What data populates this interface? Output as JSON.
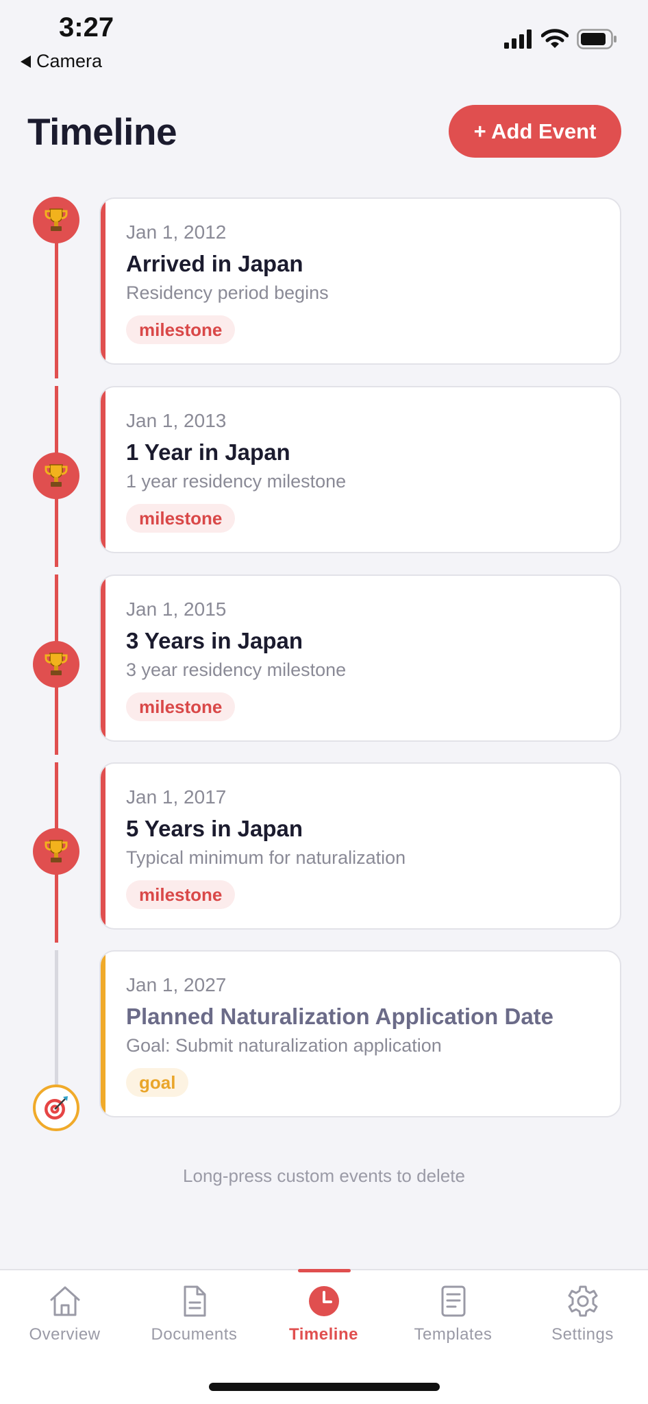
{
  "status_bar": {
    "time": "3:27",
    "back_label": "Camera"
  },
  "header": {
    "title": "Timeline",
    "add_button_label": "+ Add Event"
  },
  "events": [
    {
      "date": "Jan 1, 2012",
      "title": "Arrived in Japan",
      "description": "Residency period begins",
      "tag": "milestone",
      "icon": "trophy-icon"
    },
    {
      "date": "Jan 1, 2013",
      "title": "1 Year in Japan",
      "description": "1 year residency milestone",
      "tag": "milestone",
      "icon": "trophy-icon"
    },
    {
      "date": "Jan 1, 2015",
      "title": "3 Years in Japan",
      "description": "3 year residency milestone",
      "tag": "milestone",
      "icon": "trophy-icon"
    },
    {
      "date": "Jan 1, 2017",
      "title": "5 Years in Japan",
      "description": "Typical minimum for naturalization",
      "tag": "milestone",
      "icon": "trophy-icon"
    },
    {
      "date": "Jan 1, 2027",
      "title": "Planned Naturalization Application Date",
      "description": "Goal: Submit naturalization application",
      "tag": "goal",
      "icon": "target-icon"
    }
  ],
  "hint": "Long-press custom events to delete",
  "tabs": [
    {
      "label": "Overview",
      "icon": "home-icon",
      "active": false
    },
    {
      "label": "Documents",
      "icon": "document-icon",
      "active": false
    },
    {
      "label": "Timeline",
      "icon": "clock-icon",
      "active": true
    },
    {
      "label": "Templates",
      "icon": "template-icon",
      "active": false
    },
    {
      "label": "Settings",
      "icon": "gear-icon",
      "active": false
    }
  ],
  "colors": {
    "accent": "#E04F4F",
    "goal": "#F0AA2A",
    "background": "#F4F4F8"
  }
}
